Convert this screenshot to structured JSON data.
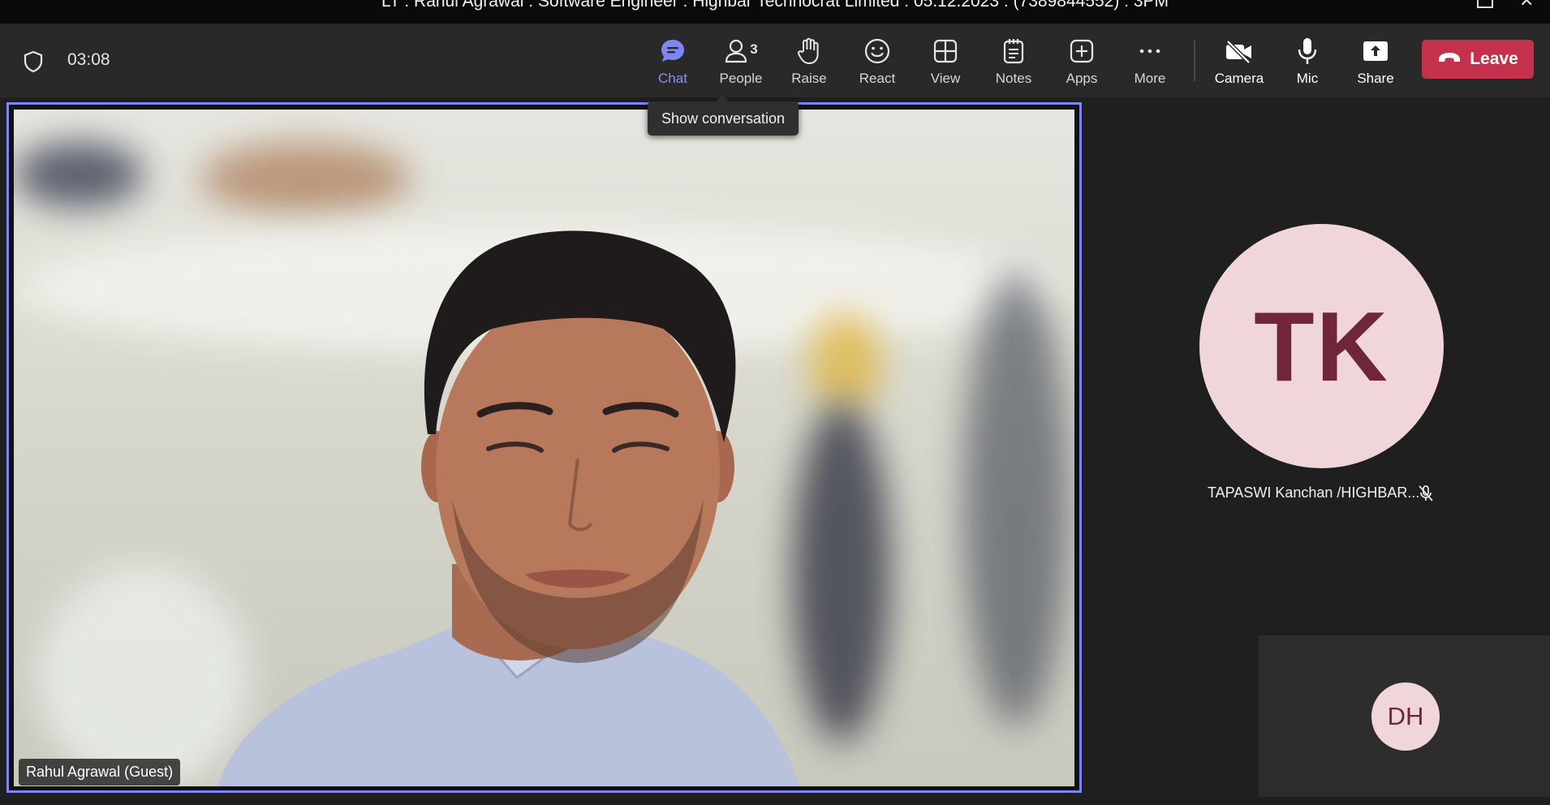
{
  "window": {
    "title": "LT : Rahul Agrawal : Software Engineer : Highbar Technocrat Limited : 05.12.2023 : (7389844552) : 3PM"
  },
  "toolbar": {
    "timer": "03:08",
    "chat_label": "Chat",
    "people_label": "People",
    "people_count": "3",
    "raise_label": "Raise",
    "react_label": "React",
    "view_label": "View",
    "notes_label": "Notes",
    "apps_label": "Apps",
    "more_label": "More",
    "camera_label": "Camera",
    "mic_label": "Mic",
    "share_label": "Share",
    "leave_label": "Leave",
    "tooltip": "Show conversation"
  },
  "stage": {
    "main_participant": "Rahul Agrawal (Guest)",
    "participant_2": {
      "initials": "TK",
      "name": "TAPASWI Kanchan /HIGHBAR..."
    },
    "participant_3": {
      "initials": "DH"
    }
  },
  "colors": {
    "accent": "#7f85f5",
    "leave": "#c4314b",
    "avatar_bg": "#f1d6d9",
    "avatar_text": "#70263a"
  }
}
